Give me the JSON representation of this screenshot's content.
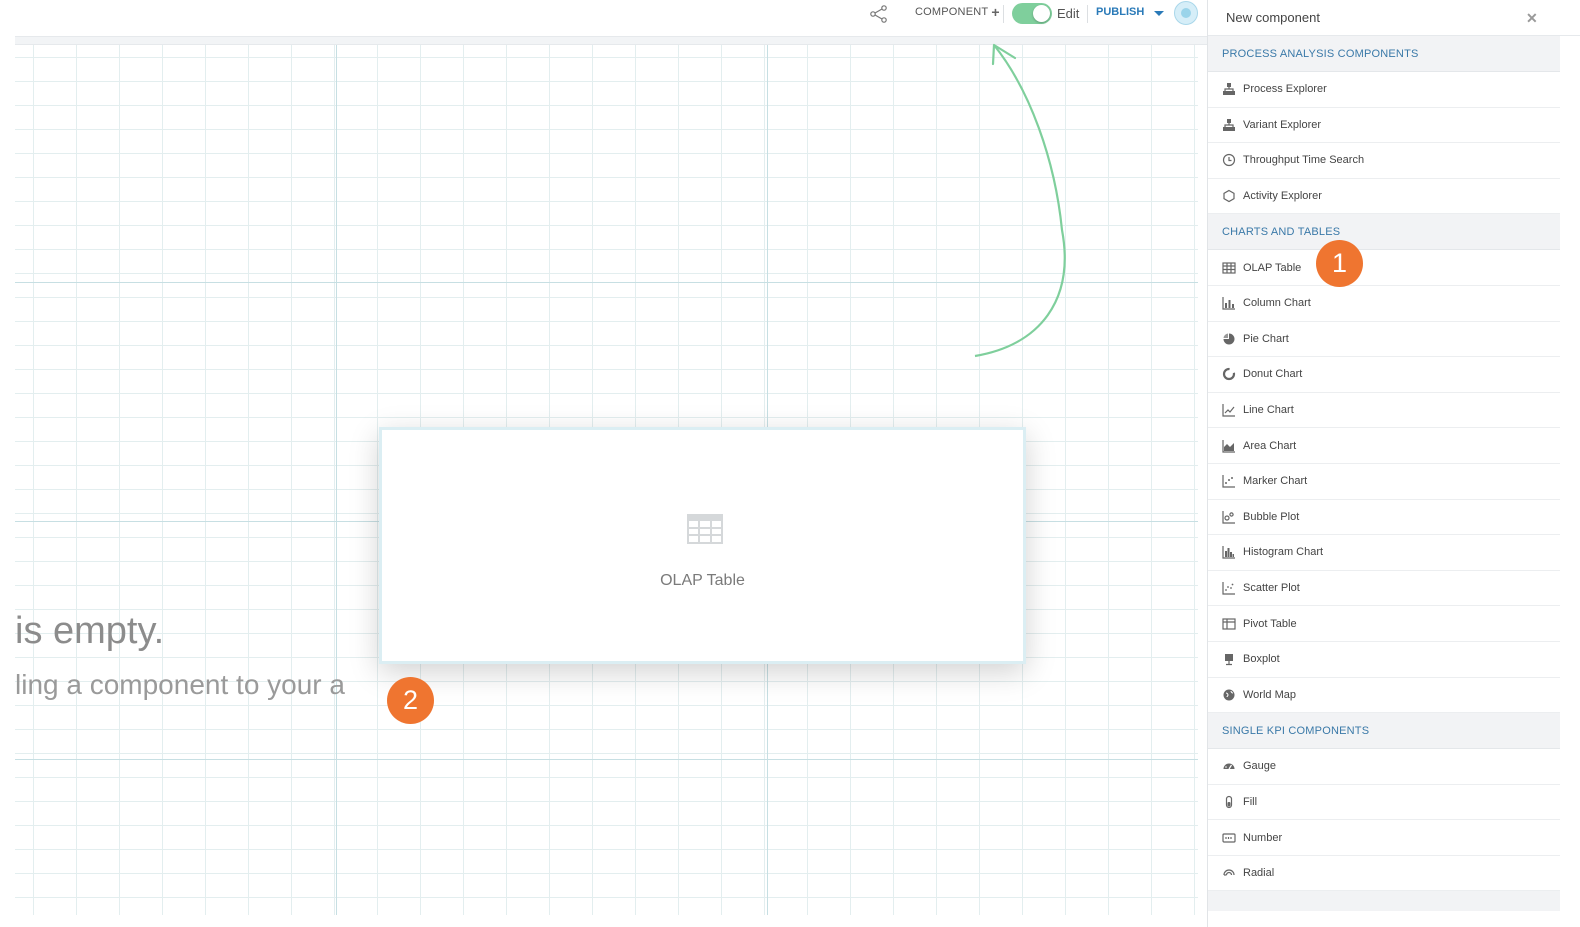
{
  "toolbar": {
    "share_icon": "share-icon",
    "component_label": "COMPONENT",
    "edit_label": "Edit",
    "edit_toggle_on": true,
    "publish_label": "PUBLISH"
  },
  "canvas": {
    "empty_title": "is empty.",
    "empty_subtitle": "ling a component to your a",
    "drag_card_label": "OLAP Table"
  },
  "badges": {
    "step1": "1",
    "step2": "2"
  },
  "colors": {
    "accent_blue": "#3a79a8",
    "toggle_green": "#7fcf9c",
    "badge_orange": "#ef7530",
    "arrow_green": "#7fcf9c"
  },
  "panel": {
    "title": "New component",
    "close_icon": "close-icon",
    "sections": [
      {
        "title": "PROCESS ANALYSIS COMPONENTS",
        "items": [
          {
            "label": "Process Explorer",
            "icon": "hierarchy-icon"
          },
          {
            "label": "Variant Explorer",
            "icon": "hierarchy-icon"
          },
          {
            "label": "Throughput Time Search",
            "icon": "clock-icon"
          },
          {
            "label": "Activity Explorer",
            "icon": "hexagon-icon"
          }
        ]
      },
      {
        "title": "CHARTS AND TABLES",
        "items": [
          {
            "label": "OLAP Table",
            "icon": "table-icon"
          },
          {
            "label": "Column Chart",
            "icon": "column-chart-icon"
          },
          {
            "label": "Pie Chart",
            "icon": "pie-chart-icon"
          },
          {
            "label": "Donut Chart",
            "icon": "donut-chart-icon"
          },
          {
            "label": "Line Chart",
            "icon": "line-chart-icon"
          },
          {
            "label": "Area Chart",
            "icon": "area-chart-icon"
          },
          {
            "label": "Marker Chart",
            "icon": "marker-chart-icon"
          },
          {
            "label": "Bubble Plot",
            "icon": "bubble-plot-icon"
          },
          {
            "label": "Histogram Chart",
            "icon": "histogram-icon"
          },
          {
            "label": "Scatter Plot",
            "icon": "scatter-plot-icon"
          },
          {
            "label": "Pivot Table",
            "icon": "pivot-table-icon"
          },
          {
            "label": "Boxplot",
            "icon": "boxplot-icon"
          },
          {
            "label": "World Map",
            "icon": "globe-icon"
          }
        ]
      },
      {
        "title": "SINGLE KPI COMPONENTS",
        "items": [
          {
            "label": "Gauge",
            "icon": "gauge-icon"
          },
          {
            "label": "Fill",
            "icon": "fill-icon"
          },
          {
            "label": "Number",
            "icon": "number-icon"
          },
          {
            "label": "Radial",
            "icon": "radial-icon"
          }
        ]
      }
    ]
  }
}
